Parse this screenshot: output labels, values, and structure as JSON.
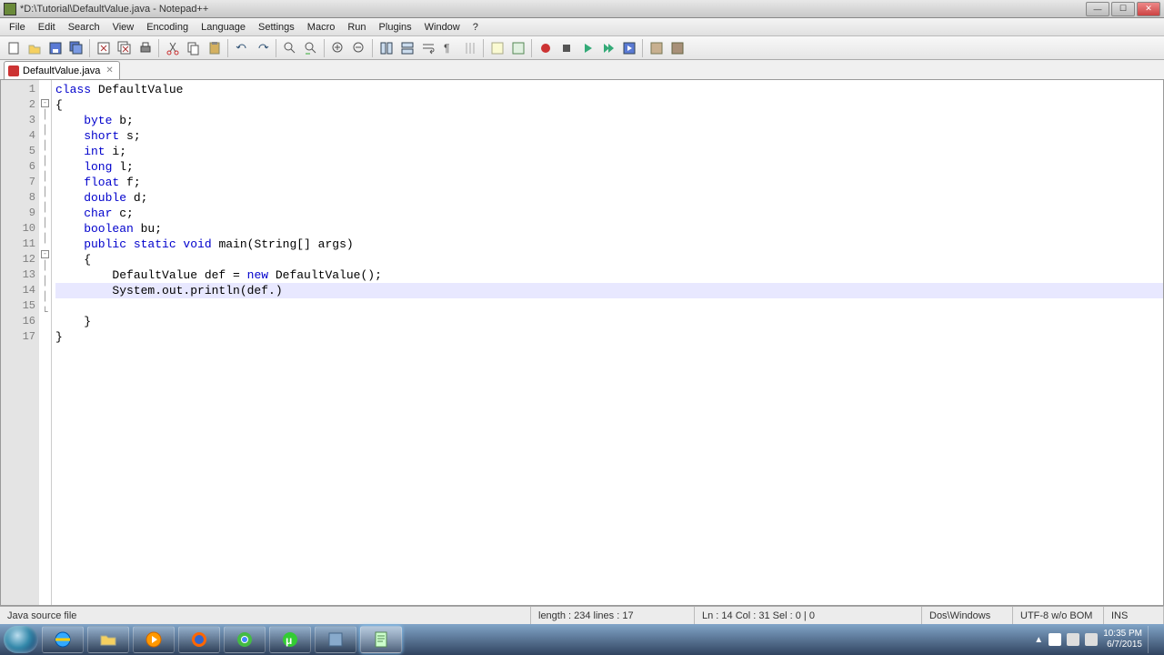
{
  "window": {
    "title": "*D:\\Tutorial\\DefaultValue.java - Notepad++"
  },
  "menu": [
    "File",
    "Edit",
    "Search",
    "View",
    "Encoding",
    "Language",
    "Settings",
    "Macro",
    "Run",
    "Plugins",
    "Window",
    "?"
  ],
  "tab": {
    "label": "DefaultValue.java"
  },
  "gutter": [
    "1",
    "2",
    "3",
    "4",
    "5",
    "6",
    "7",
    "8",
    "9",
    "10",
    "11",
    "12",
    "13",
    "14",
    "15",
    "16",
    "17"
  ],
  "code": {
    "l1a": "class",
    "l1b": " DefaultValue",
    "l2": "{",
    "l3a": "    byte",
    "l3b": " b;",
    "l4a": "    short",
    "l4b": " s;",
    "l5a": "    int",
    "l5b": " i;",
    "l6a": "    long",
    "l6b": " l;",
    "l7a": "    float",
    "l7b": " f;",
    "l8a": "    double",
    "l8b": " d;",
    "l9a": "    char",
    "l9b": " c;",
    "l10a": "    boolean",
    "l10b": " bu;",
    "l11a": "    public",
    "l11b": " static",
    "l11c": " void",
    "l11d": " main(String[] args)",
    "l12": "    {",
    "l13a": "        DefaultValue def = ",
    "l13b": "new",
    "l13c": " DefaultValue();",
    "l14": "        System.out.println(def.)",
    "l15": "        ",
    "l16": "    }",
    "l17": "}"
  },
  "status": {
    "filetype": "Java source file",
    "length": "length : 234    lines : 17",
    "pos": "Ln : 14    Col : 31    Sel : 0 | 0",
    "eol": "Dos\\Windows",
    "encoding": "UTF-8 w/o BOM",
    "mode": "INS"
  },
  "tray": {
    "time": "10:35 PM",
    "date": "6/7/2015"
  }
}
